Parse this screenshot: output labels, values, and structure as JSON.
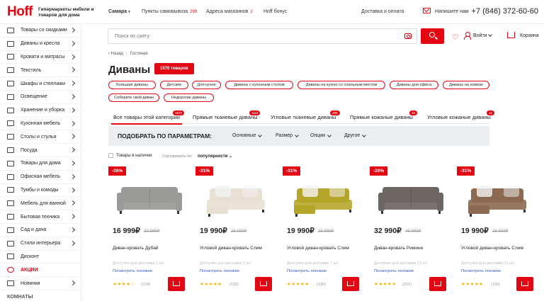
{
  "header": {
    "logo": "Hoff",
    "tagline": "Гипермаркеты мебели и товаров для дома",
    "city": "Самара",
    "pickup": "Пункты самовывоза",
    "pickup_count": "299",
    "stores": "Адреса магазинов",
    "stores_count": "2",
    "bonus": "Hoff бонус",
    "delivery": "Доставка и оплата",
    "write": "Напишите нам",
    "phone": "+7 (846) 372-60-60",
    "search_placeholder": "Поиск по сайту",
    "login": "Войти",
    "cart": "Корзина"
  },
  "sidebar": {
    "items": [
      {
        "label": "Товары со скидками"
      },
      {
        "label": "Диваны и кресла"
      },
      {
        "label": "Кровати и матрасы"
      },
      {
        "label": "Текстиль"
      },
      {
        "label": "Шкафы и стеллажи"
      },
      {
        "label": "Освещение"
      },
      {
        "label": "Хранение и уборка"
      },
      {
        "label": "Кухонная мебель"
      },
      {
        "label": "Столы и стулья"
      },
      {
        "label": "Посуда"
      },
      {
        "label": "Товары для дома"
      },
      {
        "label": "Офисная мебель"
      },
      {
        "label": "Тумбы и комоды"
      },
      {
        "label": "Мебель для ванной"
      },
      {
        "label": "Бытовая техника"
      },
      {
        "label": "Сад и дача"
      },
      {
        "label": "Стили интерьера"
      },
      {
        "label": "Дисконт"
      },
      {
        "label": "АКЦИИ"
      },
      {
        "label": "Новинки"
      }
    ],
    "caption": "КОМНАТЫ"
  },
  "breadcrumb": {
    "back": "Назад",
    "current": "Гостиная"
  },
  "title": "Диваны",
  "count_badge": "1570 товаров",
  "chips": [
    "Большие диваны",
    "Детские",
    "Для кухни",
    "Диваны с кухонным столом",
    "Диваны на кухню со спальным местом",
    "Диваны для офиса",
    "Диваны на ножках",
    "Соберите свой диван",
    "Недорогие диваны"
  ],
  "tabs": [
    {
      "label": "Все товары этой категории",
      "count": "1570"
    },
    {
      "label": "Прямые тканевые диваны",
      "count": "1118"
    },
    {
      "label": "Угловые тканевые диваны",
      "count": "299"
    },
    {
      "label": "Прямые кожаные диваны",
      "count": "46"
    },
    {
      "label": "Угловые кожаные диваны",
      "count": "16"
    }
  ],
  "filters": {
    "title": "ПОДОБРАТЬ ПО ПАРАМЕТРАМ:",
    "options": [
      "Основные",
      "Размер",
      "Опции",
      "Другое"
    ]
  },
  "in_stock_label": "Товары в наличии",
  "sort_label": "Сортировать по:",
  "sort_value": "популярности",
  "products": [
    {
      "discount": "-26%",
      "price": "16 999₽",
      "old_price": "22 999₽",
      "name": "Диван-кровать Дубай",
      "availability": "Доступен для доставки 1 шт",
      "similar": "Посмотреть похожие",
      "stars": "★★★★☆",
      "reviews": "(224)",
      "color": "#9a9a98"
    },
    {
      "discount": "-31%",
      "price": "19 990₽",
      "old_price": "28 999₽",
      "name": "Угловой диван-кровать Слим",
      "availability": "Доступен для доставки 6 шт",
      "similar": "Посмотреть похожие",
      "stars": "★★★★★",
      "reviews": "(130)",
      "color": "#e8e0d2"
    },
    {
      "discount": "-31%",
      "price": "19 990₽",
      "old_price": "28 999₽",
      "name": "Угловой диван-кровать Слим",
      "availability": "Доступен для доставки 7 шт",
      "similar": "Посмотреть похожие",
      "stars": "★★★★★",
      "reviews": "(130)",
      "color": "#b5a62a"
    },
    {
      "discount": "-28%",
      "price": "32 990₽",
      "old_price": "45 999₽",
      "name": "Диван-кровать Римини",
      "availability": "Доступен для доставки 13 шт",
      "similar": "Посмотреть похожие",
      "stars": "★★★★★",
      "reviews": "(291)",
      "color": "#6d6764"
    },
    {
      "discount": "-31%",
      "price": "19 990₽",
      "old_price": "28 999₽",
      "name": "Угловой диван-кровать Слим",
      "availability": "Доступен для доставки 11 шт",
      "similar": "Посмотреть похожие",
      "stars": "★★★★★",
      "reviews": "(130)",
      "color": "#8c6a52"
    }
  ]
}
